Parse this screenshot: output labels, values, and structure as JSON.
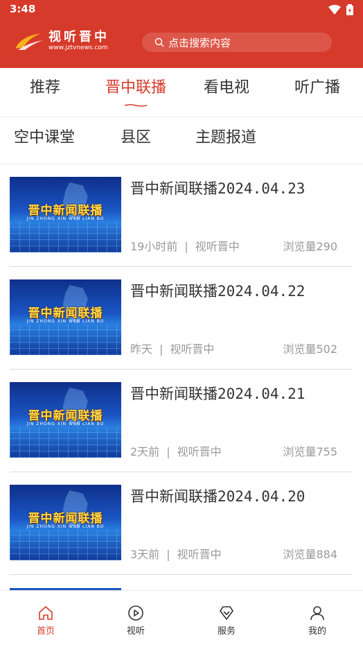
{
  "status": {
    "time": "3:48"
  },
  "header": {
    "logo_name": "视听晋中",
    "logo_url": "www.jztvnews.com",
    "search_placeholder": "点击搜索内容"
  },
  "tabs_primary": [
    {
      "label": "推荐",
      "active": false
    },
    {
      "label": "晋中联播",
      "active": true
    },
    {
      "label": "看电视",
      "active": false
    },
    {
      "label": "听广播",
      "active": false
    }
  ],
  "tabs_secondary": [
    {
      "label": "空中课堂"
    },
    {
      "label": "县区"
    },
    {
      "label": "主题报道"
    }
  ],
  "news": [
    {
      "title": "晋中新闻联播2024.04.23",
      "time": "19小时前",
      "source": "视听晋中",
      "views": "浏览量290",
      "thumb_title": "晋中新闻联播",
      "thumb_sub": "JIN ZHONG XIN WEN LIAN BO"
    },
    {
      "title": "晋中新闻联播2024.04.22",
      "time": "昨天",
      "source": "视听晋中",
      "views": "浏览量502",
      "thumb_title": "晋中新闻联播",
      "thumb_sub": "JIN ZHONG XIN WEN LIAN BO"
    },
    {
      "title": "晋中新闻联播2024.04.21",
      "time": "2天前",
      "source": "视听晋中",
      "views": "浏览量755",
      "thumb_title": "晋中新闻联播",
      "thumb_sub": "JIN ZHONG XIN WEN LIAN BO"
    },
    {
      "title": "晋中新闻联播2024.04.20",
      "time": "3天前",
      "source": "视听晋中",
      "views": "浏览量884",
      "thumb_title": "晋中新闻联播",
      "thumb_sub": "JIN ZHONG XIN WEN LIAN BO"
    }
  ],
  "meta_separator": "|",
  "bottom_nav": [
    {
      "label": "首页",
      "icon": "home-icon",
      "active": true
    },
    {
      "label": "视听",
      "icon": "play-icon",
      "active": false
    },
    {
      "label": "服务",
      "icon": "diamond-icon",
      "active": false
    },
    {
      "label": "我的",
      "icon": "user-icon",
      "active": false
    }
  ],
  "colors": {
    "brand": "#d63a2a",
    "text": "#333333",
    "meta": "#999999"
  }
}
